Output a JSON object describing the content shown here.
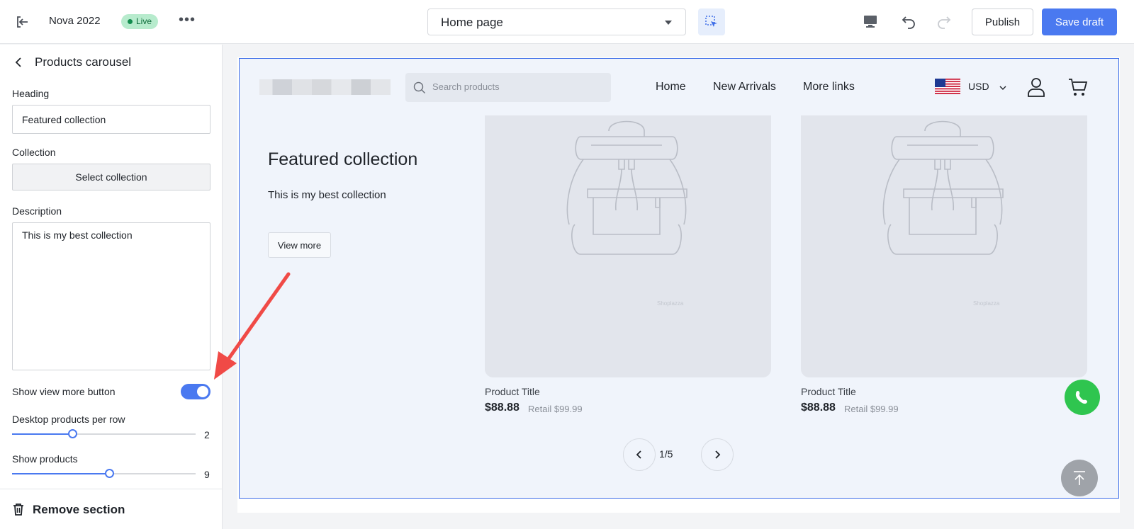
{
  "topbar": {
    "store_name": "Nova 2022",
    "status_badge": "Live",
    "more_icon": "ellipsis-icon",
    "page_selector": "Home page",
    "publish_label": "Publish",
    "save_label": "Save draft"
  },
  "sidebar": {
    "title": "Products carousel",
    "heading_label": "Heading",
    "heading_value": "Featured collection",
    "collection_label": "Collection",
    "collection_button": "Select collection",
    "description_label": "Description",
    "description_value": "This is my best collection",
    "show_view_more_label": "Show view more button",
    "show_view_more_on": true,
    "desktop_per_row_label": "Desktop products per row",
    "desktop_per_row_value": "2",
    "desktop_per_row_fraction": 0.33,
    "show_products_label": "Show products",
    "show_products_value": "9",
    "show_products_fraction": 0.53,
    "remove_label": "Remove section"
  },
  "preview": {
    "search_placeholder": "Search products",
    "nav": [
      "Home",
      "New Arrivals",
      "More links"
    ],
    "currency": "USD",
    "heading": "Featured collection",
    "description": "This is my best collection",
    "view_more": "View more",
    "products": [
      {
        "title": "Product Title",
        "price": "$88.88",
        "retail": "Retail $99.99",
        "watermark": "Shoplazza"
      },
      {
        "title": "Product Title",
        "price": "$88.88",
        "retail": "Retail $99.99",
        "watermark": "Shoplazza"
      }
    ],
    "pagination": "1/5"
  },
  "colors": {
    "accent": "#4a79f0",
    "live_bg": "#b7ebcd",
    "annotation_arrow": "#f04a46",
    "whatsapp": "#2fc54f"
  }
}
